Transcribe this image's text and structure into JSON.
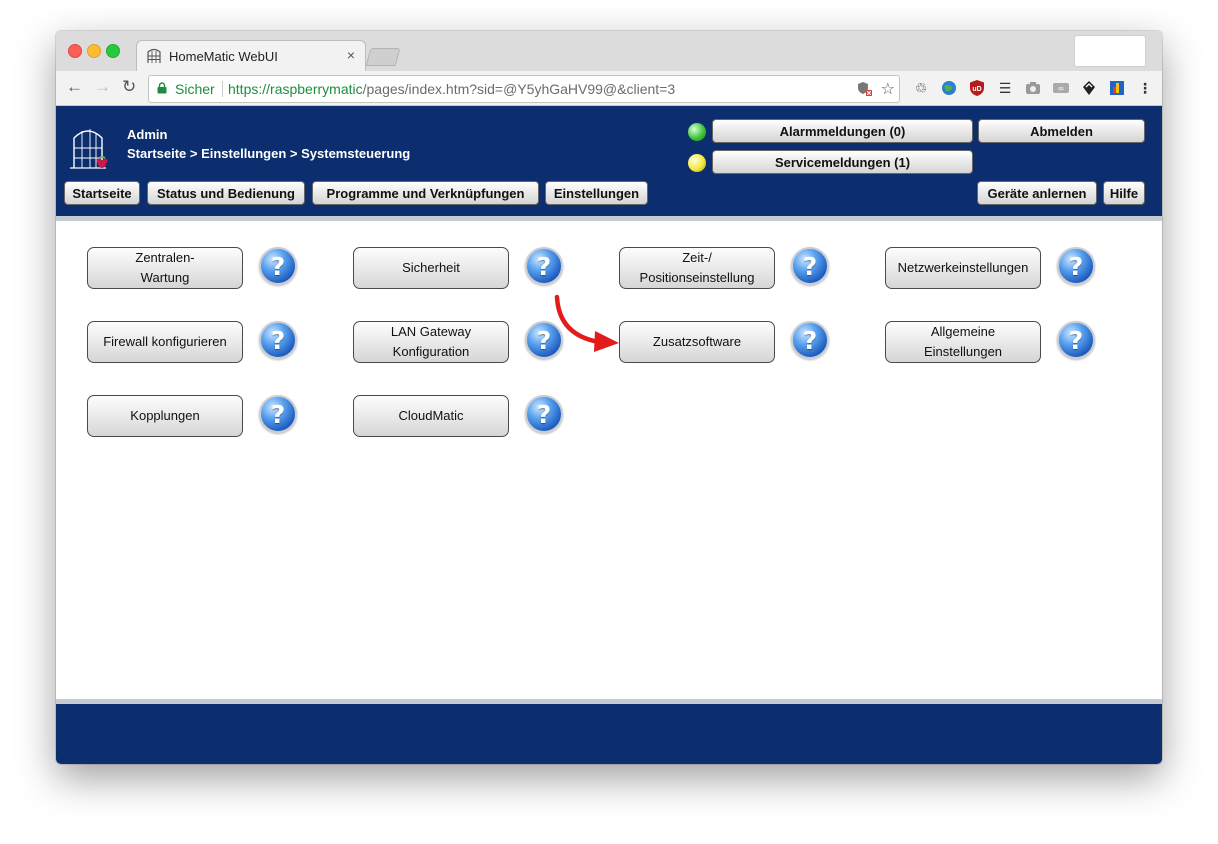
{
  "browser": {
    "tab_title": "HomeMatic WebUI",
    "tab_close": "×",
    "secure_label": "Sicher",
    "url_scheme": "https://",
    "url_host": "raspberrymatic",
    "url_rest": "/pages/index.htm?sid=@Y5yhGaHV99@&client=3"
  },
  "header": {
    "user": "Admin",
    "breadcrumb": "Startseite > Einstellungen > Systemsteuerung",
    "alarm_button": "Alarmmeldungen (0)",
    "service_button": "Servicemeldungen (1)",
    "logout_button": "Abmelden",
    "nav": {
      "home": "Startseite",
      "status": "Status und Bedienung",
      "programs": "Programme und Verknüpfungen",
      "settings": "Einstellungen",
      "teach_in": "Geräte anlernen",
      "help": "Hilfe"
    },
    "colors": {
      "brand": "#0d2e6e",
      "alarm_led": "#3ec43a",
      "service_led": "#f2e93a"
    }
  },
  "tiles": [
    {
      "label": "Zentralen-\nWartung"
    },
    {
      "label": "Sicherheit"
    },
    {
      "label": "Zeit-/\nPositionseinstellung"
    },
    {
      "label": "Netzwerkeinstellungen"
    },
    {
      "label": "Firewall konfigurieren"
    },
    {
      "label": "LAN Gateway\nKonfiguration"
    },
    {
      "label": "Zusatzsoftware"
    },
    {
      "label": "Allgemeine\nEinstellungen"
    },
    {
      "label": "Kopplungen"
    },
    {
      "label": "CloudMatic"
    }
  ],
  "help_glyph": "?",
  "annotation": {
    "icon": "red-arrow-icon",
    "color": "#e31b1b"
  }
}
